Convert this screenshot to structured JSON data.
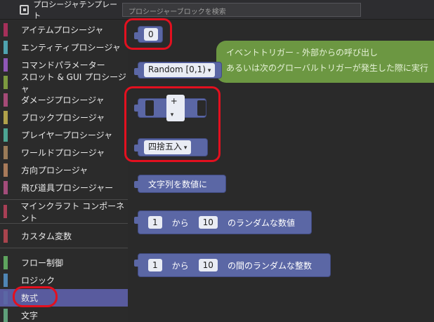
{
  "topbar": {
    "title": "プロシージャテンプレート",
    "search_placeholder": "プロシージャーブロックを検索"
  },
  "sidebar": {
    "items": [
      {
        "label": "アイテムプロシージャ",
        "color": "#a6305a"
      },
      {
        "label": "エンティティプロシージャ",
        "color": "#4fa3b0"
      },
      {
        "label": "コマンドパラメーター",
        "color": "#8f57b6"
      },
      {
        "label": "スロット & GUI プロシージャ",
        "color": "#7c9a3f"
      },
      {
        "label": "ダメージプロシージャ",
        "color": "#a54a77"
      },
      {
        "label": "ブロックプロシージャ",
        "color": "#b0a14a"
      },
      {
        "label": "プレイヤープロシージャ",
        "color": "#4da593"
      },
      {
        "label": "ワールドプロシージャ",
        "color": "#9a7b58"
      },
      {
        "label": "方向プロシージャ",
        "color": "#a87a5a"
      },
      {
        "label": "飛び道具プロシージャー",
        "color": "#a34c7a"
      },
      {
        "label": "マインクラフト コンポーネント",
        "color": "#a83f55"
      },
      {
        "label": "カスタム変数",
        "color": "#a9444d"
      },
      {
        "label": "フロー制御",
        "color": "#5ea55e"
      },
      {
        "label": "ロジック",
        "color": "#4f86b5"
      },
      {
        "label": "数式",
        "color": "#5b67a5"
      },
      {
        "label": "文字",
        "color": "#5fa07a"
      }
    ]
  },
  "tooltip": {
    "line1": "イベントトリガー - 外部からの呼び出し",
    "line2": "あるいは次のグローバルトリガーが発生した際に実行"
  },
  "blocks": {
    "number_value": "0",
    "random_label": "Random [0,1)",
    "op_symbol": "+",
    "round_label": "四捨五入",
    "text_to_number": "文字列を数値に",
    "rand_range": {
      "from": "1",
      "kara": "から",
      "to": "10",
      "suffix": "のランダムな数値"
    },
    "rand_int": {
      "from": "1",
      "kara": "から",
      "to": "10",
      "suffix": "の間のランダムな整数"
    }
  }
}
